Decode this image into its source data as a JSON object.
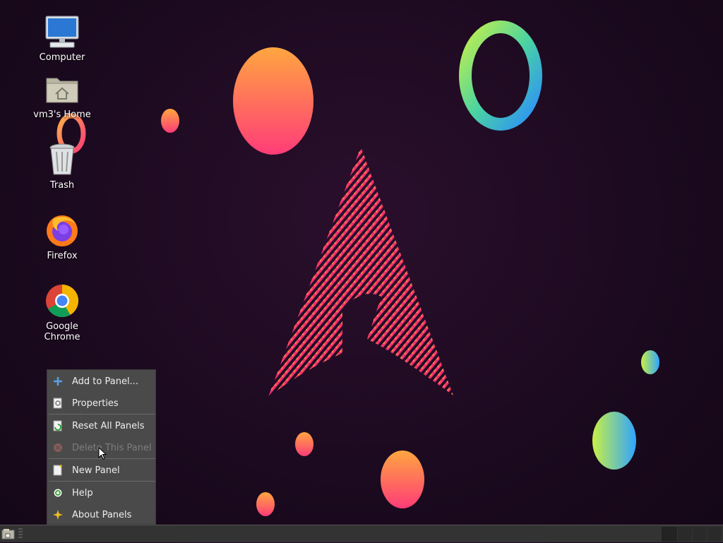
{
  "desktop": {
    "icons": [
      {
        "label": "Computer",
        "icon": "computer-icon"
      },
      {
        "label": "vm3's Home",
        "icon": "home-folder-icon"
      },
      {
        "label": "Trash",
        "icon": "trash-icon"
      },
      {
        "label": "Firefox",
        "icon": "firefox-icon"
      },
      {
        "label": "Google Chrome",
        "icon": "chrome-icon"
      }
    ]
  },
  "context_menu": {
    "items": [
      {
        "label": "Add to Panel...",
        "icon": "plus-icon",
        "enabled": true
      },
      {
        "label": "Properties",
        "icon": "properties-icon",
        "enabled": true
      },
      {
        "label": "Reset All Panels",
        "icon": "reset-icon",
        "enabled": true
      },
      {
        "label": "Delete This Panel",
        "icon": "delete-icon",
        "enabled": false
      },
      {
        "label": "New Panel",
        "icon": "new-panel-icon",
        "enabled": true
      },
      {
        "label": "Help",
        "icon": "help-icon",
        "enabled": true
      },
      {
        "label": "About Panels",
        "icon": "star-icon",
        "enabled": true
      }
    ]
  },
  "colors": {
    "menu_bg": "#4a4a4a",
    "panel_bg": "#333333",
    "wallpaper_bg": "#1c0a20"
  }
}
